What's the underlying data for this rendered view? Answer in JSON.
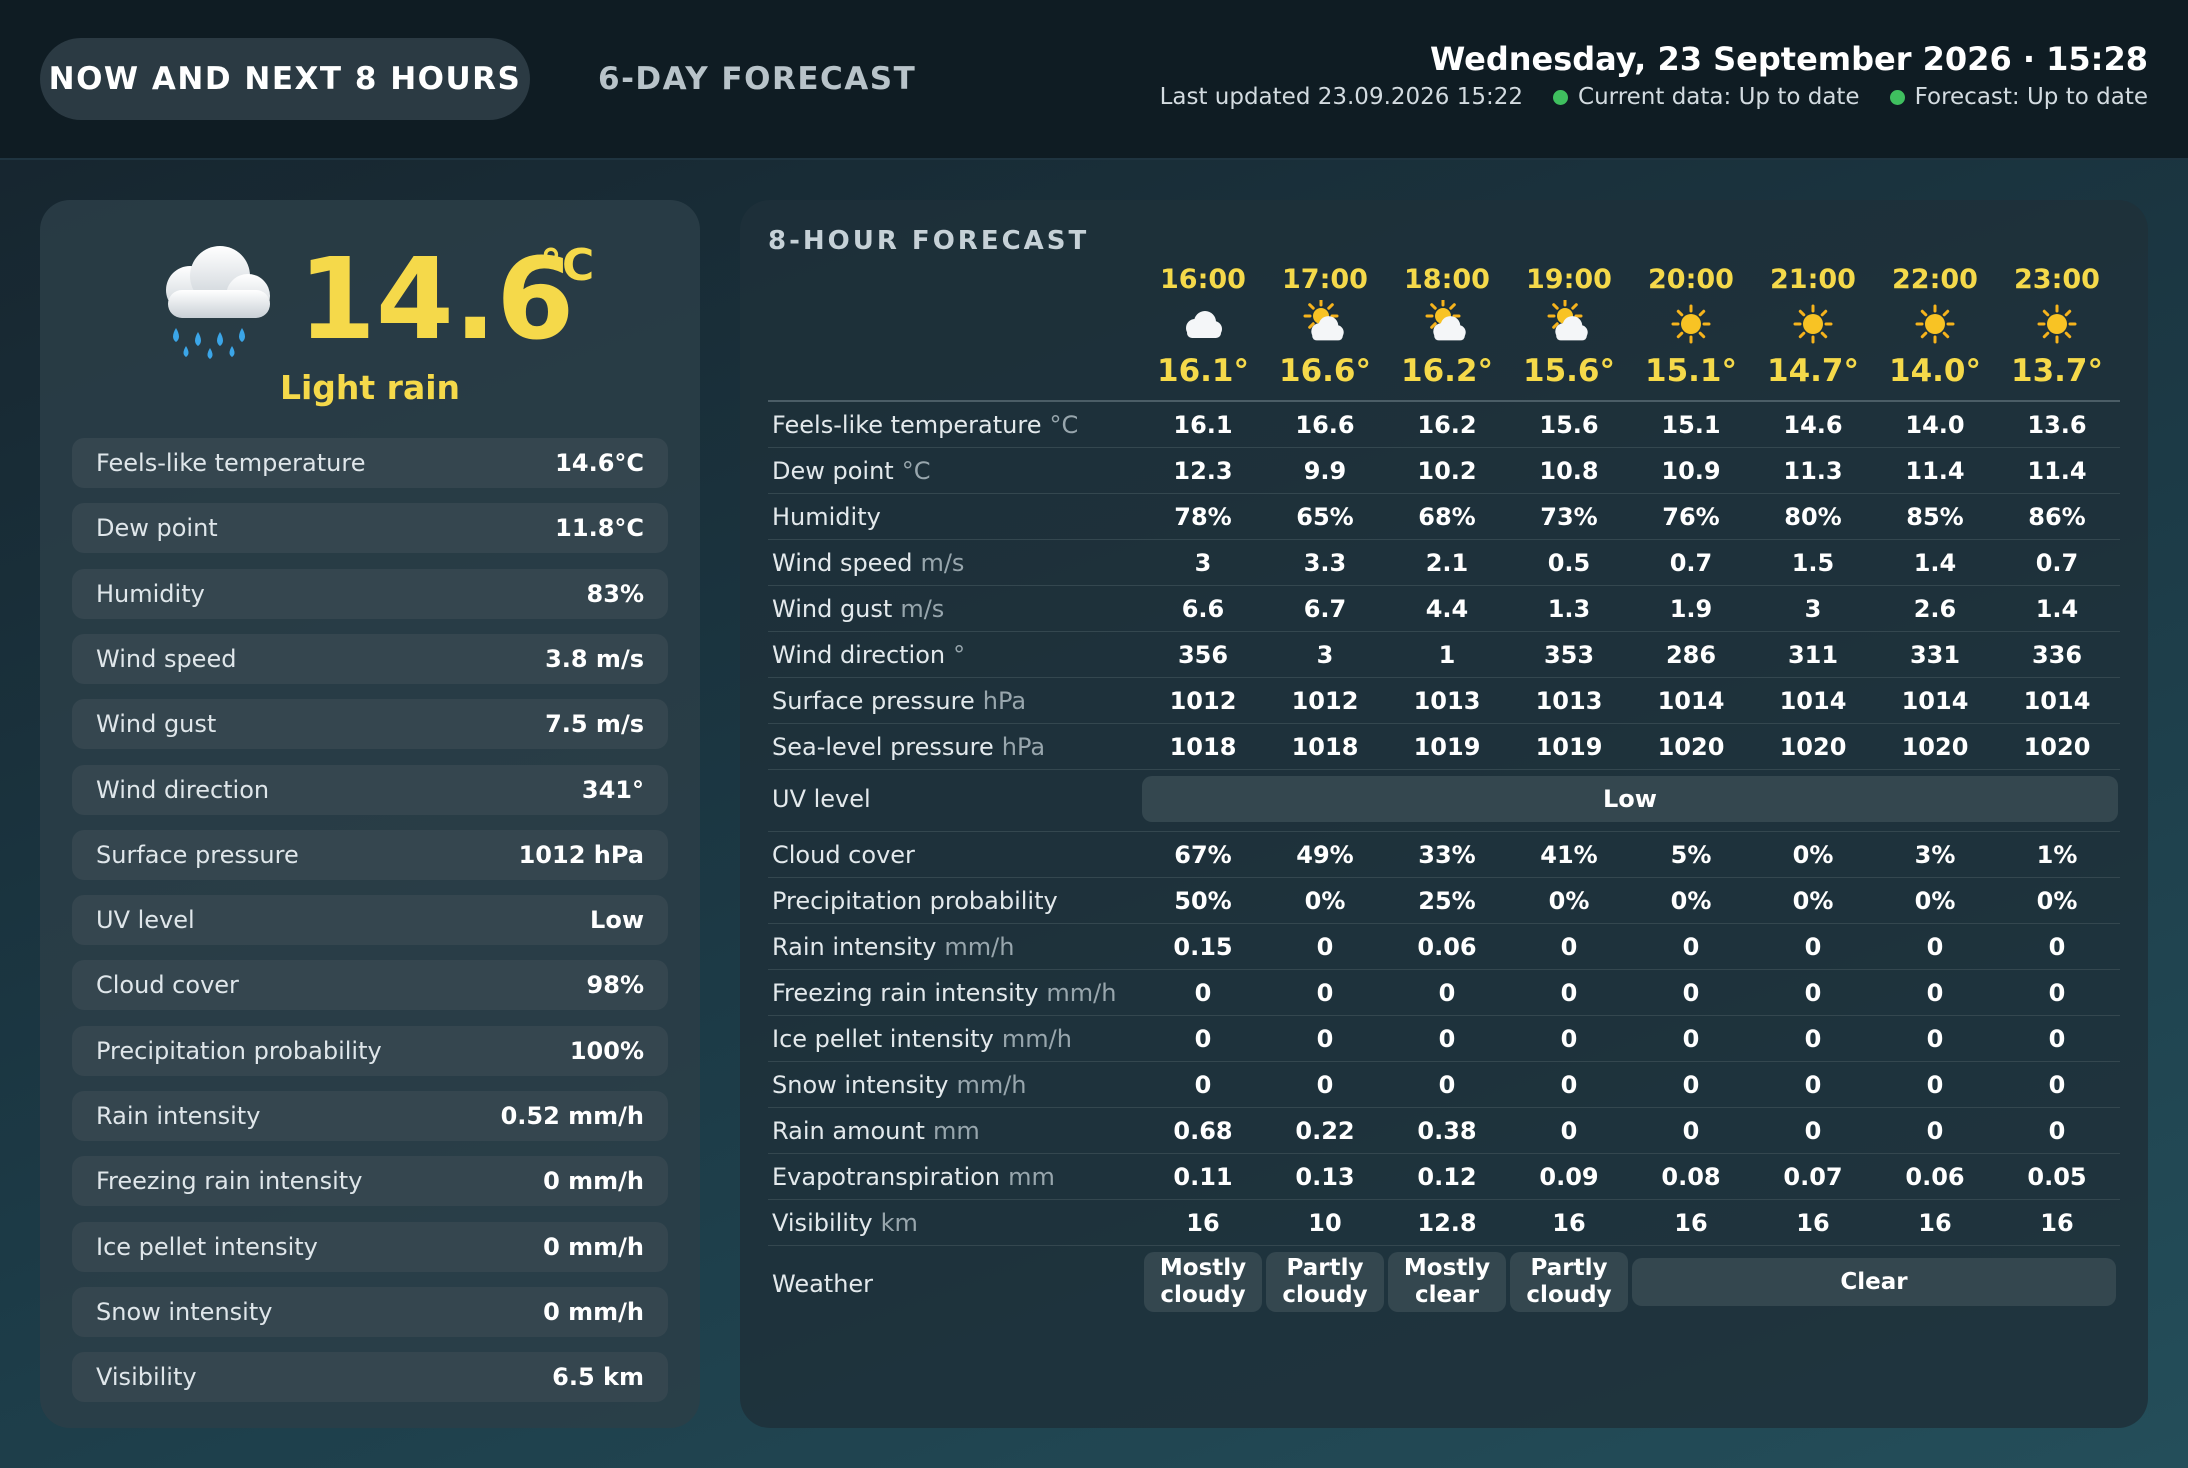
{
  "header": {
    "tab_now": "NOW AND NEXT 8 HOURS",
    "tab_forecast": "6-DAY FORECAST",
    "datetime": "Wednesday, 23 September 2026 · 15:28",
    "last_updated": "Last updated 23.09.2026 15:22",
    "current_status": "Current data: Up to date",
    "forecast_status": "Forecast: Up to date",
    "status_color": "#3fbf5f"
  },
  "current": {
    "icon": "rain-cloud-icon",
    "temperature": "14.6",
    "unit": "°C",
    "condition": "Light rain",
    "metrics": [
      {
        "label": "Feels-like temperature",
        "value": "14.6°C"
      },
      {
        "label": "Dew point",
        "value": "11.8°C"
      },
      {
        "label": "Humidity",
        "value": "83%"
      },
      {
        "label": "Wind speed",
        "value": "3.8 m/s"
      },
      {
        "label": "Wind gust",
        "value": "7.5 m/s"
      },
      {
        "label": "Wind direction",
        "value": "341°"
      },
      {
        "label": "Surface pressure",
        "value": "1012 hPa"
      },
      {
        "label": "UV level",
        "value": "Low"
      },
      {
        "label": "Cloud cover",
        "value": "98%"
      },
      {
        "label": "Precipitation probability",
        "value": "100%"
      },
      {
        "label": "Rain intensity",
        "value": "0.52 mm/h"
      },
      {
        "label": "Freezing rain intensity",
        "value": "0 mm/h"
      },
      {
        "label": "Ice pellet intensity",
        "value": "0 mm/h"
      },
      {
        "label": "Snow intensity",
        "value": "0 mm/h"
      },
      {
        "label": "Visibility",
        "value": "6.5 km"
      }
    ]
  },
  "forecast": {
    "title": "8-HOUR FORECAST",
    "hours": [
      {
        "time": "16:00",
        "icon": "cloud-icon",
        "temp": "16.1°"
      },
      {
        "time": "17:00",
        "icon": "sun-behind-cloud-icon",
        "temp": "16.6°"
      },
      {
        "time": "18:00",
        "icon": "sun-behind-cloud-icon",
        "temp": "16.2°"
      },
      {
        "time": "19:00",
        "icon": "sun-behind-cloud-icon",
        "temp": "15.6°"
      },
      {
        "time": "20:00",
        "icon": "sun-icon",
        "temp": "15.1°"
      },
      {
        "time": "21:00",
        "icon": "sun-icon",
        "temp": "14.7°"
      },
      {
        "time": "22:00",
        "icon": "sun-icon",
        "temp": "14.0°"
      },
      {
        "time": "23:00",
        "icon": "sun-icon",
        "temp": "13.7°"
      }
    ],
    "rows_a": [
      {
        "label": "Feels-like temperature",
        "unit": "°C",
        "values": [
          "16.1",
          "16.6",
          "16.2",
          "15.6",
          "15.1",
          "14.6",
          "14.0",
          "13.6"
        ]
      },
      {
        "label": "Dew point",
        "unit": "°C",
        "values": [
          "12.3",
          "9.9",
          "10.2",
          "10.8",
          "10.9",
          "11.3",
          "11.4",
          "11.4"
        ]
      },
      {
        "label": "Humidity",
        "unit": "",
        "values": [
          "78%",
          "65%",
          "68%",
          "73%",
          "76%",
          "80%",
          "85%",
          "86%"
        ]
      },
      {
        "label": "Wind speed",
        "unit": "m/s",
        "values": [
          "3",
          "3.3",
          "2.1",
          "0.5",
          "0.7",
          "1.5",
          "1.4",
          "0.7"
        ]
      },
      {
        "label": "Wind gust",
        "unit": "m/s",
        "values": [
          "6.6",
          "6.7",
          "4.4",
          "1.3",
          "1.9",
          "3",
          "2.6",
          "1.4"
        ]
      },
      {
        "label": "Wind direction",
        "unit": "°",
        "values": [
          "356",
          "3",
          "1",
          "353",
          "286",
          "311",
          "331",
          "336"
        ]
      },
      {
        "label": "Surface pressure",
        "unit": "hPa",
        "values": [
          "1012",
          "1012",
          "1013",
          "1013",
          "1014",
          "1014",
          "1014",
          "1014"
        ]
      },
      {
        "label": "Sea-level pressure",
        "unit": "hPa",
        "values": [
          "1018",
          "1018",
          "1019",
          "1019",
          "1020",
          "1020",
          "1020",
          "1020"
        ]
      }
    ],
    "uv": {
      "label": "UV level",
      "value": "Low"
    },
    "rows_b": [
      {
        "label": "Cloud cover",
        "unit": "",
        "values": [
          "67%",
          "49%",
          "33%",
          "41%",
          "5%",
          "0%",
          "3%",
          "1%"
        ]
      },
      {
        "label": "Precipitation probability",
        "unit": "",
        "values": [
          "50%",
          "0%",
          "25%",
          "0%",
          "0%",
          "0%",
          "0%",
          "0%"
        ]
      },
      {
        "label": "Rain intensity",
        "unit": "mm/h",
        "values": [
          "0.15",
          "0",
          "0.06",
          "0",
          "0",
          "0",
          "0",
          "0"
        ]
      },
      {
        "label": "Freezing rain intensity",
        "unit": "mm/h",
        "values": [
          "0",
          "0",
          "0",
          "0",
          "0",
          "0",
          "0",
          "0"
        ]
      },
      {
        "label": "Ice pellet intensity",
        "unit": "mm/h",
        "values": [
          "0",
          "0",
          "0",
          "0",
          "0",
          "0",
          "0",
          "0"
        ]
      },
      {
        "label": "Snow intensity",
        "unit": "mm/h",
        "values": [
          "0",
          "0",
          "0",
          "0",
          "0",
          "0",
          "0",
          "0"
        ]
      },
      {
        "label": "Rain amount",
        "unit": "mm",
        "values": [
          "0.68",
          "0.22",
          "0.38",
          "0",
          "0",
          "0",
          "0",
          "0"
        ]
      },
      {
        "label": "Evapotranspiration",
        "unit": "mm",
        "values": [
          "0.11",
          "0.13",
          "0.12",
          "0.09",
          "0.08",
          "0.07",
          "0.06",
          "0.05"
        ]
      },
      {
        "label": "Visibility",
        "unit": "km",
        "values": [
          "16",
          "10",
          "12.8",
          "16",
          "16",
          "16",
          "16",
          "16"
        ]
      }
    ],
    "weather": {
      "label": "Weather",
      "groups": [
        {
          "text": "Mostly cloudy",
          "span": 1
        },
        {
          "text": "Partly cloudy",
          "span": 1
        },
        {
          "text": "Mostly clear",
          "span": 1
        },
        {
          "text": "Partly cloudy",
          "span": 1
        },
        {
          "text": "Clear",
          "span": 4
        }
      ]
    }
  }
}
